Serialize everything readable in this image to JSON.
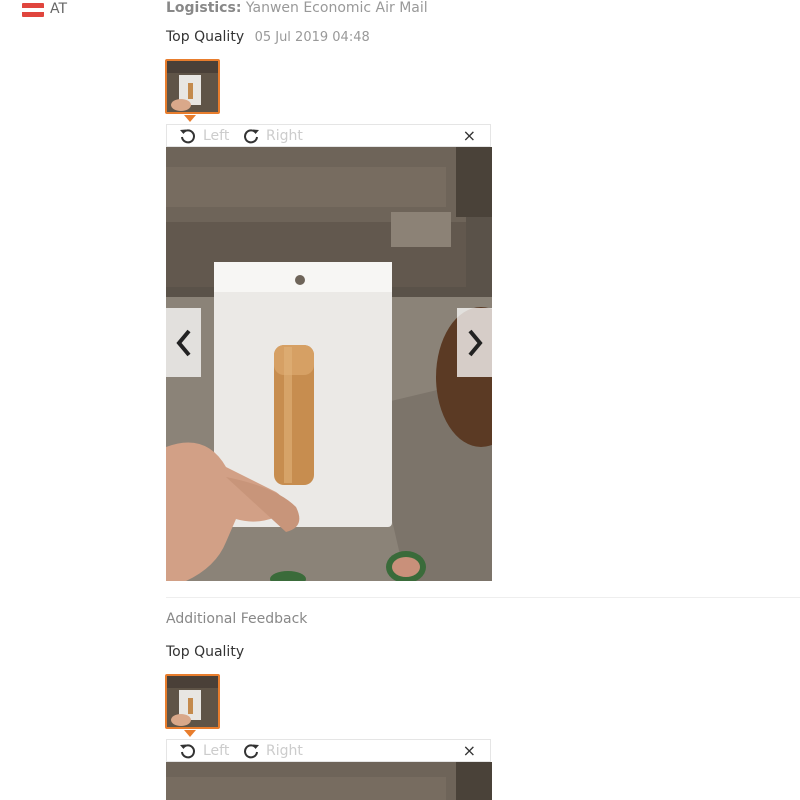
{
  "reviewer": {
    "country": "AT"
  },
  "logistics": {
    "label": "Logistics:",
    "value": "Yanwen Economic Air Mail"
  },
  "feedback": {
    "text": "Top Quality",
    "date": "05 Jul 2019 04:48"
  },
  "viewer": {
    "rotate_left": "Left",
    "rotate_right": "Right",
    "close": "×"
  },
  "additional": {
    "label": "Additional Feedback",
    "text": "Top Quality"
  },
  "colors": {
    "accent": "#e87d2d",
    "flag_red": "#e0453d"
  }
}
